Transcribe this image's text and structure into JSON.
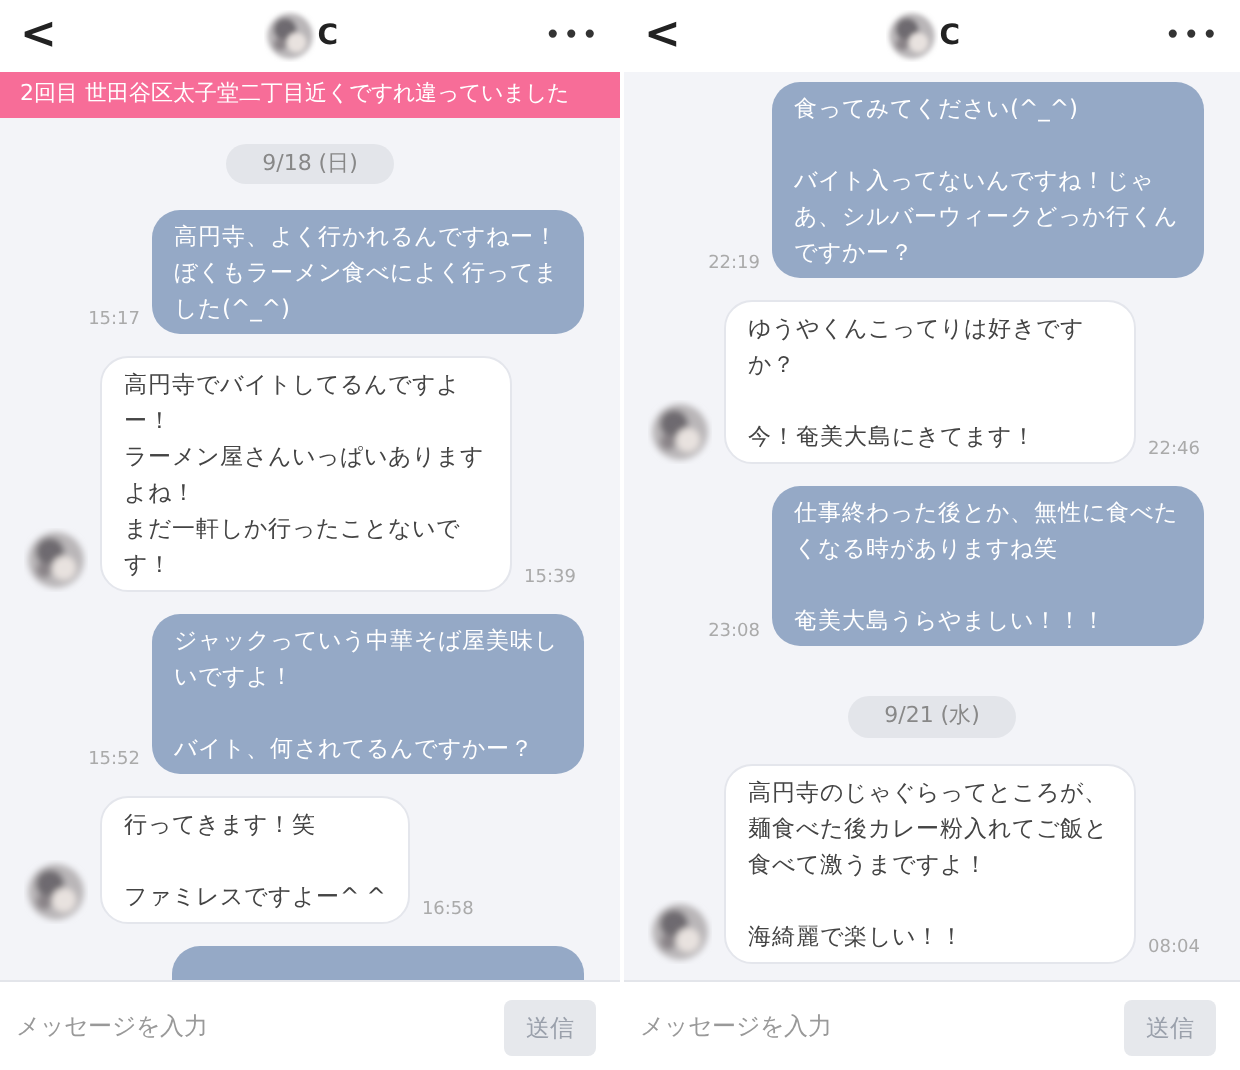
{
  "screens": [
    {
      "header": {
        "back": "<",
        "name": "C",
        "more": "•••"
      },
      "banner": "2回目 世田谷区太子堂二丁目近くですれ違っていました",
      "items": [
        {
          "kind": "date",
          "text": "9/18 (日)"
        },
        {
          "kind": "sent",
          "paragraphs": [
            [
              "高円寺、よく行かれるんですねー！ぼくもラーメン食べによく行ってました(^_^)"
            ]
          ],
          "time": "15:17"
        },
        {
          "kind": "received",
          "paragraphs": [
            [
              "高円寺でバイトしてるんですよー！",
              "ラーメン屋さんいっぱいありますよね！",
              "まだ一軒しか行ったことないです！"
            ]
          ],
          "time": "15:39"
        },
        {
          "kind": "sent",
          "paragraphs": [
            [
              "ジャックっていう中華そば屋美味しいですよ！"
            ],
            [
              "バイト、何されてるんですかー？"
            ]
          ],
          "time": "15:52"
        },
        {
          "kind": "received",
          "paragraphs": [
            [
              "行ってきます！笑"
            ],
            [
              "ファミレスですよー^ ^"
            ]
          ],
          "time": "16:58"
        },
        {
          "kind": "partial_sent"
        }
      ],
      "input": {
        "placeholder": "メッセージを入力",
        "send": "送信",
        "disabled": true
      }
    },
    {
      "header": {
        "back": "<",
        "name": "C",
        "more": "•••"
      },
      "items": [
        {
          "kind": "sent",
          "paragraphs": [
            [
              "食ってみてください(^_^)"
            ],
            [
              "バイト入ってないんですね！じゃあ、シルバーウィークどっか行くんですかー？"
            ]
          ],
          "time": "22:19"
        },
        {
          "kind": "received",
          "paragraphs": [
            [
              "ゆうやくんこってりは好きですか？"
            ],
            [
              "今！奄美大島にきてます！"
            ]
          ],
          "time": "22:46"
        },
        {
          "kind": "sent",
          "paragraphs": [
            [
              "仕事終わった後とか、無性に食べたくなる時がありますね笑"
            ],
            [
              "奄美大島うらやましい！！！"
            ]
          ],
          "time": "23:08"
        },
        {
          "kind": "date",
          "text": "9/21 (水)"
        },
        {
          "kind": "received",
          "paragraphs": [
            [
              "高円寺のじゃぐらってところが、麺食べた後カレー粉入れてご飯と食べて激うまですよ！"
            ],
            [
              "海綺麗で楽しい！！"
            ]
          ],
          "time": "08:04"
        }
      ],
      "input": {
        "placeholder": "メッセージを入力",
        "send": "送信",
        "disabled": true
      }
    }
  ]
}
